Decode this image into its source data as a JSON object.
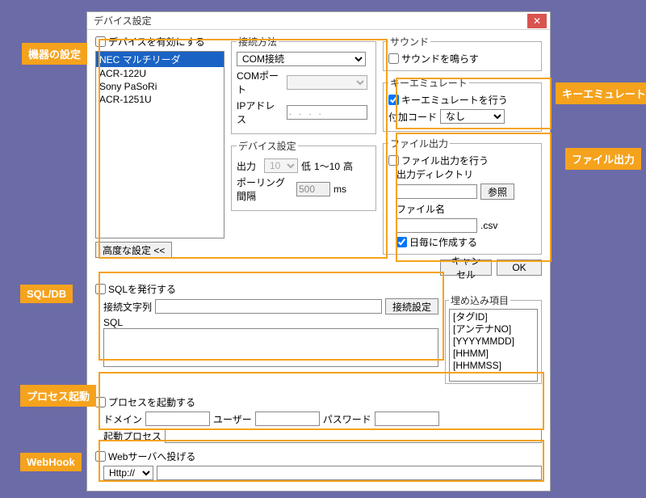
{
  "window": {
    "title": "デバイス設定"
  },
  "devices": {
    "enable_label": "デバイスを有効にする",
    "items": [
      "NEC マルチリーダ",
      "ACR-122U",
      "Sony PaSoRi",
      "ACR-1251U"
    ]
  },
  "connection": {
    "legend": "接続方法",
    "type_value": "COM接続",
    "comport_label": "COMポート",
    "ip_label": "IPアドレス"
  },
  "device_settings": {
    "legend": "デバイス設定",
    "output_label": "出力",
    "output_value": "10",
    "range_low": "低",
    "range_txt": "1～10",
    "range_high": "高",
    "polling_label": "ポーリング間隔",
    "polling_value": "500",
    "polling_unit": "ms"
  },
  "advanced_btn": "高度な設定 <<",
  "sound": {
    "legend": "サウンド",
    "label": "サウンドを鳴らす"
  },
  "keyemu": {
    "legend": "キーエミュレート",
    "enable_label": "キーエミュレートを行う",
    "addcode_label": "付加コード",
    "addcode_value": "なし"
  },
  "fileout": {
    "legend": "ファイル出力",
    "enable_label": "ファイル出力を行う",
    "dir_label": "出力ディレクトリ",
    "browse": "参照",
    "filename_label": "ファイル名",
    "ext": ".csv",
    "daily_label": "日毎に作成する"
  },
  "buttons": {
    "cancel": "キャンセル",
    "ok": "OK"
  },
  "sql": {
    "enable_label": "SQLを発行する",
    "conn_label": "接続文字列",
    "conn_btn": "接続設定",
    "sql_label": "SQL"
  },
  "embed": {
    "legend": "埋め込み項目",
    "items": [
      "[タグID]",
      "[アンテナNO]",
      "[YYYYMMDD]",
      "[HHMM]",
      "[HHMMSS]"
    ]
  },
  "process": {
    "enable_label": "プロセスを起動する",
    "domain_label": "ドメイン",
    "user_label": "ユーザー",
    "password_label": "パスワード",
    "exec_label": "起動プロセス"
  },
  "webhook": {
    "enable_label": "Webサーバへ投げる",
    "scheme": "Http://"
  },
  "callouts": {
    "device": "機器の設定",
    "keyemu": "キーエミュレート",
    "fileout": "ファイル出力",
    "sql": "SQL/DB",
    "process": "プロセス起動",
    "webhook": "WebHook"
  }
}
